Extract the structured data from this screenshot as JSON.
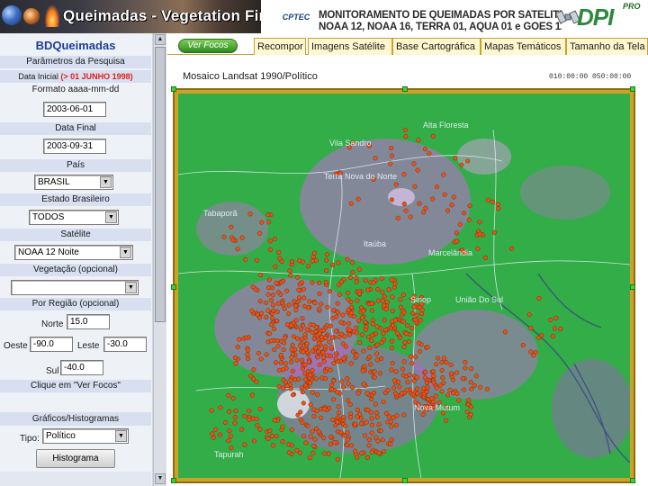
{
  "banner": {
    "title": "Queimadas - Vegetation Fires",
    "cptec_logo": "CPTEC",
    "monitor_line1": "MONITORAMENTO DE QUEIMADAS POR SATÉLITE",
    "monitor_line2": "NOAA 12, NOAA 16, TERRA 01, AQUA 01 e GOES 12",
    "dpi_logo": "DPI",
    "pro_logo": "PRO"
  },
  "sidebar": {
    "title": "BDQueimadas",
    "params_heading": "Parâmetros da Pesquisa",
    "data_inicial_label": "Data Inicial",
    "data_inicial_note": "(> 01 JUNHO 1998)",
    "format_hint": "Formato aaaa-mm-dd",
    "start_date": "2003-06-01",
    "data_final_label": "Data Final",
    "end_date": "2003-09-31",
    "pais_label": "País",
    "pais_value": "BRASIL",
    "estado_label": "Estado Brasileiro",
    "estado_value": "TODOS",
    "satelite_label": "Satélite",
    "satelite_value": "NOAA 12 Noite",
    "vegetacao_label": "Vegetação (opcional)",
    "vegetacao_value": "",
    "regiao_label": "Por Região (opcional)",
    "norte_label": "Norte",
    "norte_value": "15.0",
    "oeste_label": "Oeste",
    "oeste_value": "-90.0",
    "leste_label": "Leste",
    "leste_value": "-30.0",
    "sul_label": "Sul",
    "sul_value": "-40.0",
    "clique_hint": "Clique em \"Ver Focos\"",
    "graficos_heading": "Gráficos/Histogramas",
    "tipo_label": "Tipo:",
    "tipo_value": "Político",
    "histograma_button": "Histograma"
  },
  "toolbar": {
    "ver_focos": "Ver Focos",
    "tabs": [
      "Recompor",
      "Imagens Satélite",
      "Base Cartográfica",
      "Mapas Temáticos",
      "Tamanho da Tela"
    ]
  },
  "map": {
    "title": "Mosaico Landsat 1990/Político",
    "coords_readout": "010:00:00 050:00:00",
    "place_labels": [
      "Vila Sandro",
      "Alta Floresta",
      "Terra Nova do Norte",
      "Tabaporã",
      "Itaúba",
      "Marcelândia",
      "Sinop",
      "União Do Sul",
      "Nova Mutum",
      "Tapurah"
    ],
    "colors": {
      "forest": "#35b04a",
      "cleared_land": "#c26ad8",
      "fire_marker": "#e8531a",
      "frame": "#c9a227"
    }
  }
}
